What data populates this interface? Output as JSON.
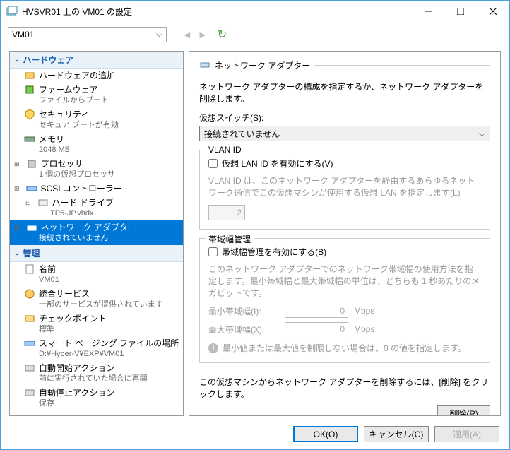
{
  "window": {
    "title": "HVSVR01 上の VM01 の設定"
  },
  "toolbar": {
    "vm_selected": "VM01"
  },
  "sidebar": {
    "hardware_header": "ハードウェア",
    "management_header": "管理",
    "items": {
      "add_hardware": "ハードウェアの追加",
      "firmware": "ファームウェア",
      "firmware_sub": "ファイルからブート",
      "security": "セキュリティ",
      "security_sub": "セキュア ブートが有効",
      "memory": "メモリ",
      "memory_sub": "2048 MB",
      "processor": "プロセッサ",
      "processor_sub": "1 個の仮想プロセッサ",
      "scsi": "SCSI コントローラー",
      "harddrive": "ハード ドライブ",
      "harddrive_sub": "TP5-JP.vhdx",
      "netadapter": "ネットワーク アダプター",
      "netadapter_sub": "接続されていません",
      "name": "名前",
      "name_sub": "VM01",
      "integration": "統合サービス",
      "integration_sub": "一部のサービスが提供されています",
      "checkpoint": "チェックポイント",
      "checkpoint_sub": "標準",
      "paging": "スマート ページング ファイルの場所",
      "paging_sub": "D:¥Hyper-V¥EXP¥VM01",
      "autostart": "自動開始アクション",
      "autostart_sub": "前に実行されていた場合に再開",
      "autostop": "自動停止アクション",
      "autostop_sub": "保存"
    }
  },
  "content": {
    "title": "ネットワーク アダプター",
    "desc": "ネットワーク アダプターの構成を指定するか、ネットワーク アダプターを削除します。",
    "vswitch_label": "仮想スイッチ(S):",
    "vswitch_value": "接続されていません",
    "vlan": {
      "legend": "VLAN ID",
      "checkbox": "仮想 LAN ID を有効にする(V)",
      "desc": "VLAN ID は、このネットワーク アダプターを経由するあらゆるネットワーク通信でこの仮想マシンが使用する仮想 LAN を指定します(L)",
      "value": "2"
    },
    "bandwidth": {
      "legend": "帯域幅管理",
      "checkbox": "帯域幅管理を有効にする(B)",
      "desc": "このネットワーク アダプターでのネットワーク帯域幅の使用方法を指定します。最小帯域幅と最大帯域幅の単位は、どちらも 1 秒あたりのメガビットです。",
      "min_label": "最小帯域幅(I):",
      "min_value": "0",
      "max_label": "最大帯域幅(X):",
      "max_value": "0",
      "unit": "Mbps",
      "info": "最小値または最大値を制限しない場合は、0 の値を指定します。"
    },
    "remove_text": "この仮想マシンからネットワーク アダプターを削除するには、[削除] をクリックします。",
    "remove_button": "削除(R)"
  },
  "footer": {
    "ok": "OK(O)",
    "cancel": "キャンセル(C)",
    "apply": "適用(A)"
  }
}
